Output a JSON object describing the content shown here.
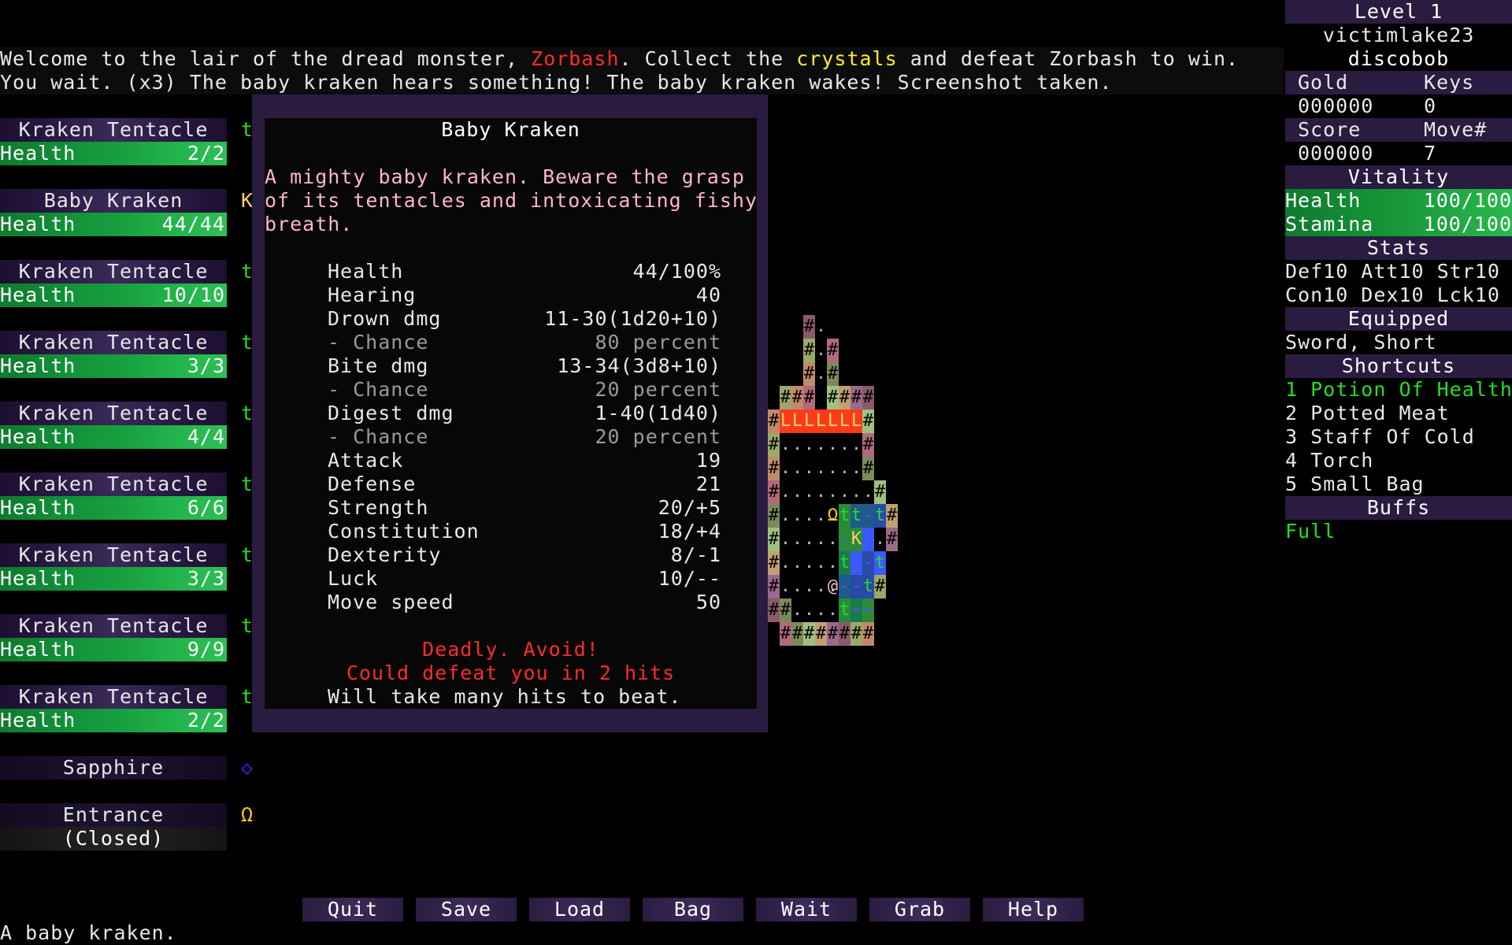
{
  "log": {
    "line1": {
      "a": "Welcome to the lair of the dread monster, ",
      "b": "Zorbash",
      "c": ". Collect the ",
      "d": "crystals",
      "e": " and defeat Zorbash to win."
    },
    "line2": "You wait. (x3) The baby kraken hears something! The baby kraken wakes! Screenshot taken."
  },
  "monsters": [
    {
      "name": "Kraken Tentacle",
      "health_label": "Health",
      "health": "2/2",
      "symbol": "t"
    },
    {
      "name": "Baby Kraken",
      "health_label": "Health",
      "health": "44/44",
      "symbol": "K"
    },
    {
      "name": "Kraken Tentacle",
      "health_label": "Health",
      "health": "10/10",
      "symbol": "t"
    },
    {
      "name": "Kraken Tentacle",
      "health_label": "Health",
      "health": "3/3",
      "symbol": "t"
    },
    {
      "name": "Kraken Tentacle",
      "health_label": "Health",
      "health": "4/4",
      "symbol": "t"
    },
    {
      "name": "Kraken Tentacle",
      "health_label": "Health",
      "health": "6/6",
      "symbol": "t"
    },
    {
      "name": "Kraken Tentacle",
      "health_label": "Health",
      "health": "3/3",
      "symbol": "t"
    },
    {
      "name": "Kraken Tentacle",
      "health_label": "Health",
      "health": "9/9",
      "symbol": "t"
    },
    {
      "name": "Kraken Tentacle",
      "health_label": "Health",
      "health": "2/2",
      "symbol": "t"
    }
  ],
  "items": {
    "sapphire": {
      "name": "Sapphire",
      "symbol": "◇"
    },
    "entrance": {
      "name": "Entrance",
      "state": "(Closed)",
      "symbol": "Ω"
    }
  },
  "panel": {
    "title": "Baby Kraken",
    "desc1": "A mighty baby kraken. Beware the grasp",
    "desc2": "of its tentacles and intoxicating fishy",
    "desc3": "breath.",
    "stats": [
      {
        "k": "Health",
        "v": "44/100%"
      },
      {
        "k": "Hearing",
        "v": "40"
      },
      {
        "k": "Drown dmg",
        "v": "11-30(1d20+10)"
      },
      {
        "k": "- Chance",
        "v": "80 percent"
      },
      {
        "k": "Bite dmg",
        "v": "13-34(3d8+10)"
      },
      {
        "k": "- Chance",
        "v": "20 percent"
      },
      {
        "k": "Digest dmg",
        "v": "1-40(1d40)"
      },
      {
        "k": "- Chance",
        "v": "20 percent"
      },
      {
        "k": "Attack",
        "v": "19"
      },
      {
        "k": "Defense",
        "v": "21"
      },
      {
        "k": "Strength",
        "v": "20/+5"
      },
      {
        "k": "Constitution",
        "v": "18/+4"
      },
      {
        "k": "Dexterity",
        "v": "8/-1"
      },
      {
        "k": "Luck",
        "v": "10/--"
      },
      {
        "k": "Move speed",
        "v": "50"
      }
    ],
    "warn1": "Deadly. Avoid!",
    "warn2": "Could defeat you in 2 hits",
    "note": "Will take many hits to beat."
  },
  "sidebar": {
    "level": "Level 1",
    "seed": "victimlake23",
    "player": "discobob",
    "gold_label": "Gold",
    "keys_label": "Keys",
    "gold": "000000",
    "keys": "0",
    "score_label": "Score",
    "move_label": "Move#",
    "score": "000000",
    "move": "7",
    "vitality_label": "Vitality",
    "health_label": "Health",
    "health": "100/100",
    "stamina_label": "Stamina",
    "stamina": "100/100",
    "stats_label": "Stats",
    "stats_line1": "Def10 Att10 Str10",
    "stats_line2": "Con10 Dex10 Lck10",
    "equipped_label": "Equipped",
    "equipped": "Sword, Short",
    "shortcuts_label": "Shortcuts",
    "shortcuts": [
      "1 Potion Of Health",
      "2 Potted Meat",
      "3 Staff Of Cold",
      "4 Torch",
      "5 Small Bag"
    ],
    "buffs_label": "Buffs",
    "buffs": "Full"
  },
  "buttons": [
    "Quit",
    "Save",
    "Load",
    "Bag",
    "Wait",
    "Grab",
    "Help"
  ],
  "status": "A baby kraken."
}
